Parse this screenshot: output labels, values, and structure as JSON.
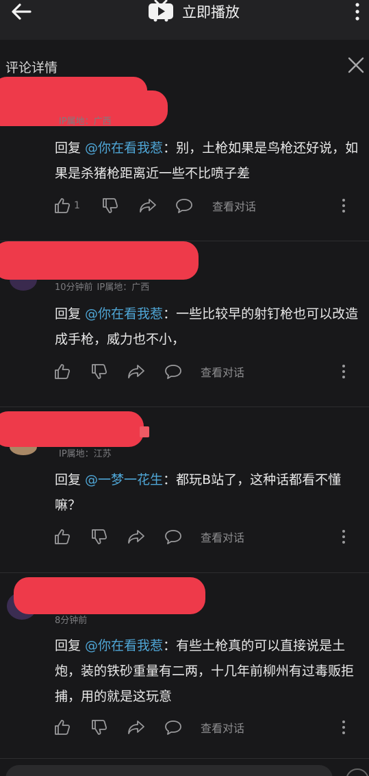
{
  "topbar": {
    "title": "立即播放"
  },
  "panel": {
    "title": "评论详情"
  },
  "comments": [
    {
      "time": "",
      "ip": "IP属地：广西",
      "reply_label": "回复 ",
      "mention": "@你在看我惹",
      "text": "：别，土枪如果是鸟枪还好说，如果是杀猪枪距离近一些不比喷子差",
      "likes": "1",
      "view_conversation": "查看对话"
    },
    {
      "time": "10分钟前",
      "ip": "IP属地：广西",
      "reply_label": "回复 ",
      "mention": "@你在看我惹",
      "text": "：一些比较早的射钉枪也可以改造成手枪，威力也不小，",
      "likes": "",
      "view_conversation": "查看对话"
    },
    {
      "time": "",
      "ip": "IP属地：江苏",
      "reply_label": "回复 ",
      "mention": "@一梦一花生",
      "text": "：都玩B站了，这种话都看不懂嘛？",
      "likes": "",
      "view_conversation": "查看对话"
    },
    {
      "time": "8分钟前",
      "ip": "",
      "reply_label": "回复 ",
      "mention": "@你在看我惹",
      "text": "：有些土枪真的可以直接说是土炮，装的铁砂重量有二两，十几年前柳州有过毒贩拒捕，用的就是这玩意",
      "likes": "",
      "view_conversation": "查看对话"
    }
  ],
  "colors": {
    "background": "#18181a",
    "mention": "#4fa6d6",
    "redaction": "#ee3a4a"
  }
}
